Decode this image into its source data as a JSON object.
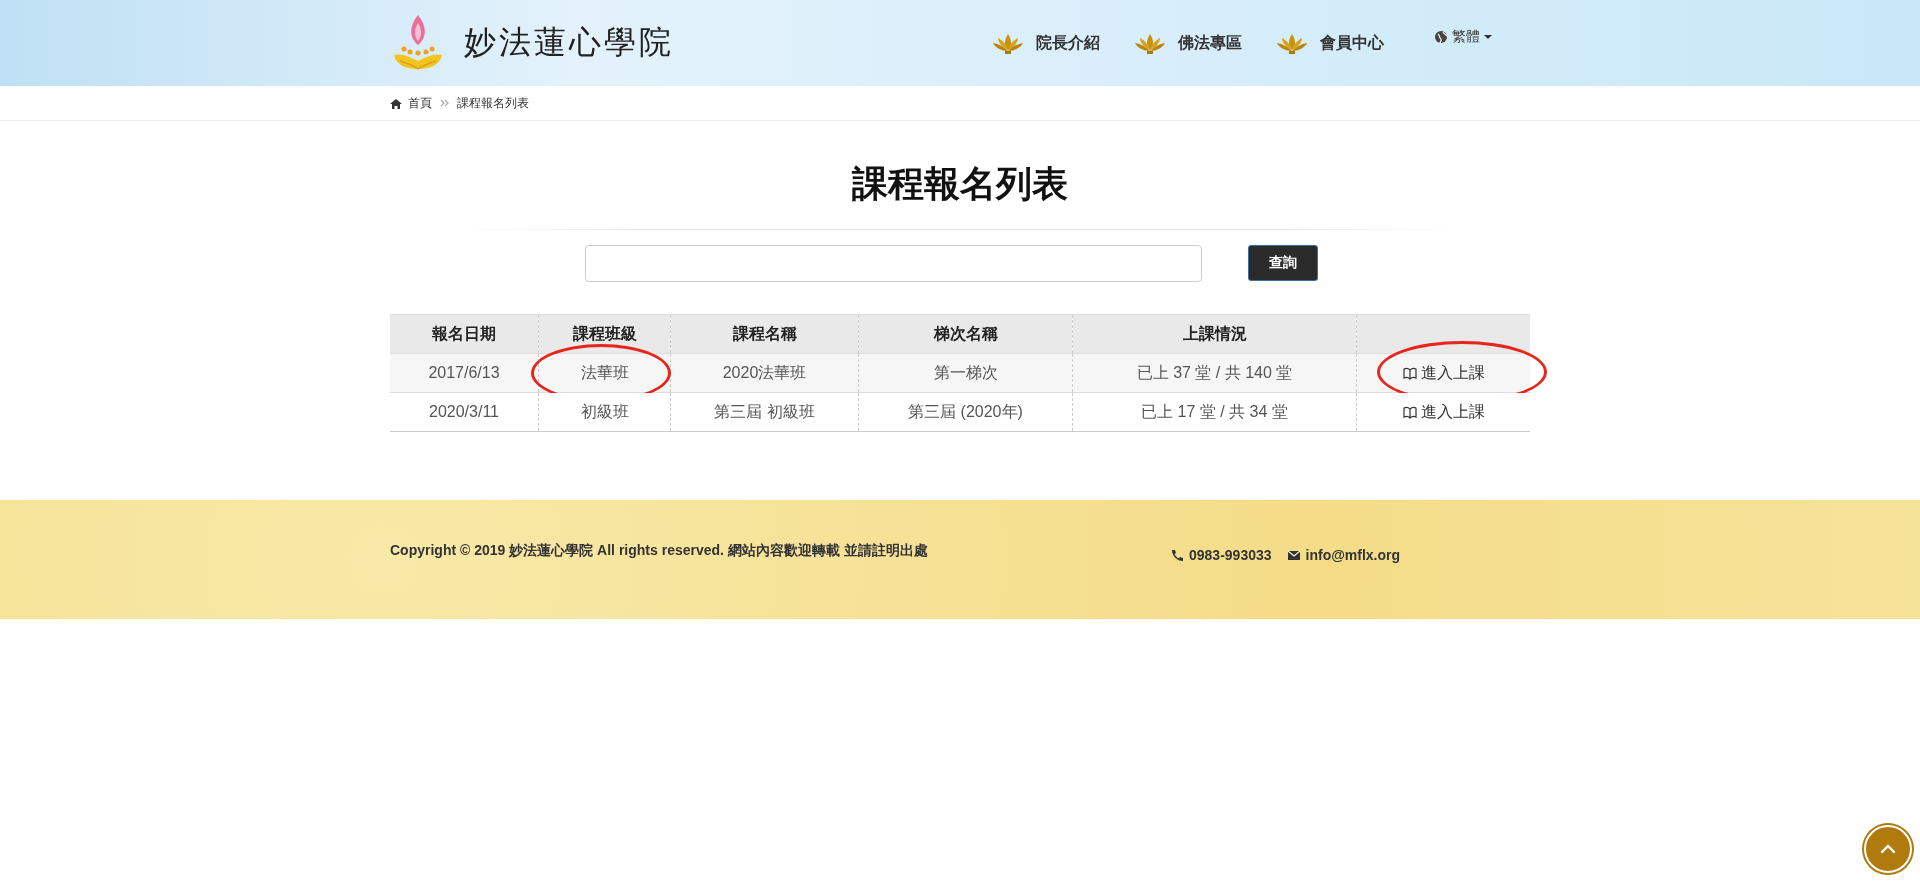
{
  "header": {
    "site_title": "妙法蓮心學院",
    "nav": [
      {
        "label": "院長介紹"
      },
      {
        "label": "佛法專區"
      },
      {
        "label": "會員中心"
      }
    ],
    "language": "繁體"
  },
  "breadcrumb": [
    "首頁",
    "課程報名列表"
  ],
  "page_title": "課程報名列表",
  "search": {
    "button": "查詢"
  },
  "table": {
    "columns": [
      "報名日期",
      "課程班級",
      "課程名稱",
      "梯次名稱",
      "上課情況",
      ""
    ],
    "rows": [
      {
        "cells": [
          "2017/6/13",
          "法華班",
          "2020法華班",
          "第一梯次",
          "已上 37 堂 / 共 140 堂"
        ],
        "action": "進入上課",
        "circled_class": true,
        "circled_action": true
      },
      {
        "cells": [
          "2020/3/11",
          "初級班",
          "第三屆 初級班",
          "第三屆 (2020年)",
          "已上 17 堂 / 共 34 堂"
        ],
        "action": "進入上課",
        "circled_class": false,
        "circled_action": false
      }
    ]
  },
  "footer": {
    "copyright": "Copyright © 2019 妙法蓮心學院 All rights reserved. 網站內容歡迎轉載 並請註明出處",
    "phone": "0983-993033",
    "email": "info@mflx.org"
  }
}
